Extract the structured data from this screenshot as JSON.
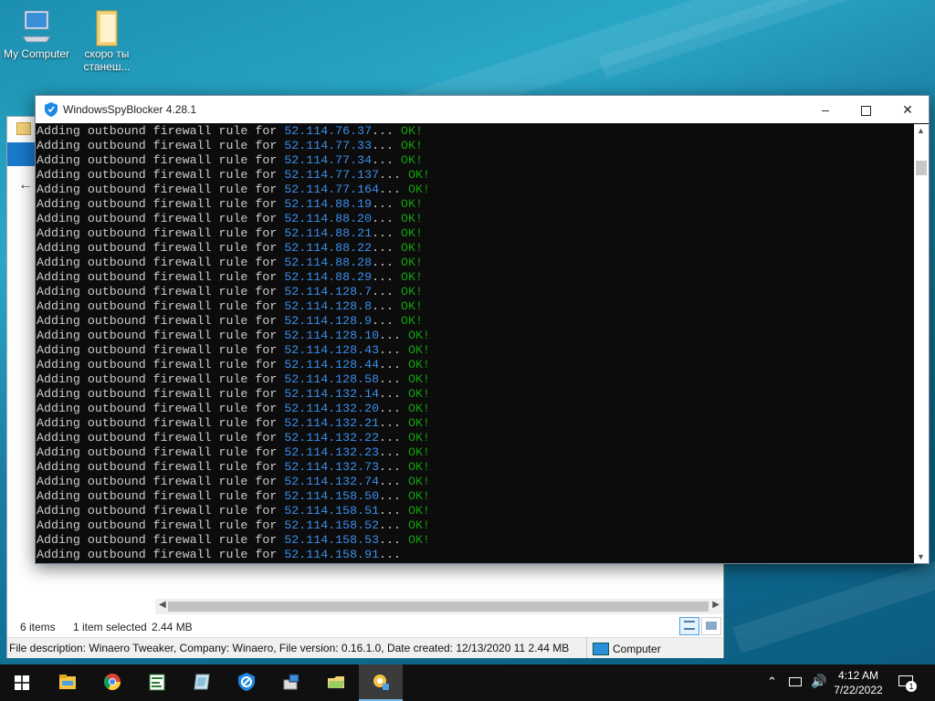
{
  "desktop": {
    "icons": [
      {
        "label": "My Computer",
        "icon": "computer-icon"
      },
      {
        "label": "скоро ты станеш...",
        "icon": "folder-icon"
      }
    ]
  },
  "explorer": {
    "status_items": "6 items",
    "status_selected": "1 item selected",
    "status_size": "2.44 MB",
    "details_text": "File description: Winaero Tweaker, Company: Winaero, File version: 0.16.1.0, Date created: 12/13/2020 11 2.44 MB",
    "location_label": "Computer"
  },
  "console": {
    "title": "WindowsSpyBlocker 4.28.1",
    "prefix": "Adding outbound firewall rule for ",
    "lines": [
      {
        "ip": "52.114.76.37",
        "status": "OK!"
      },
      {
        "ip": "52.114.77.33",
        "status": "OK!"
      },
      {
        "ip": "52.114.77.34",
        "status": "OK!"
      },
      {
        "ip": "52.114.77.137",
        "status": "OK!"
      },
      {
        "ip": "52.114.77.164",
        "status": "OK!"
      },
      {
        "ip": "52.114.88.19",
        "status": "OK!"
      },
      {
        "ip": "52.114.88.20",
        "status": "OK!"
      },
      {
        "ip": "52.114.88.21",
        "status": "OK!"
      },
      {
        "ip": "52.114.88.22",
        "status": "OK!"
      },
      {
        "ip": "52.114.88.28",
        "status": "OK!"
      },
      {
        "ip": "52.114.88.29",
        "status": "OK!"
      },
      {
        "ip": "52.114.128.7",
        "status": "OK!"
      },
      {
        "ip": "52.114.128.8",
        "status": "OK!"
      },
      {
        "ip": "52.114.128.9",
        "status": "OK!"
      },
      {
        "ip": "52.114.128.10",
        "status": "OK!"
      },
      {
        "ip": "52.114.128.43",
        "status": "OK!"
      },
      {
        "ip": "52.114.128.44",
        "status": "OK!"
      },
      {
        "ip": "52.114.128.58",
        "status": "OK!"
      },
      {
        "ip": "52.114.132.14",
        "status": "OK!"
      },
      {
        "ip": "52.114.132.20",
        "status": "OK!"
      },
      {
        "ip": "52.114.132.21",
        "status": "OK!"
      },
      {
        "ip": "52.114.132.22",
        "status": "OK!"
      },
      {
        "ip": "52.114.132.23",
        "status": "OK!"
      },
      {
        "ip": "52.114.132.73",
        "status": "OK!"
      },
      {
        "ip": "52.114.132.74",
        "status": "OK!"
      },
      {
        "ip": "52.114.158.50",
        "status": "OK!"
      },
      {
        "ip": "52.114.158.51",
        "status": "OK!"
      },
      {
        "ip": "52.114.158.52",
        "status": "OK!"
      },
      {
        "ip": "52.114.158.53",
        "status": "OK!"
      },
      {
        "ip": "52.114.158.91",
        "status": ""
      }
    ]
  },
  "taskbar": {
    "apps": [
      "start-icon",
      "file-explorer-icon",
      "chrome-icon",
      "notepad-icon",
      "app-icon",
      "windowsspyblocker-icon",
      "network-app-icon",
      "folder-app-icon",
      "winaero-tweaker-icon"
    ],
    "time": "4:12 AM",
    "date": "7/22/2022",
    "notification_count": "1"
  },
  "colors": {
    "ip": "#3b8eea",
    "ok": "#13a10e",
    "text": "#cccccc",
    "console_bg": "#0c0c0c"
  }
}
